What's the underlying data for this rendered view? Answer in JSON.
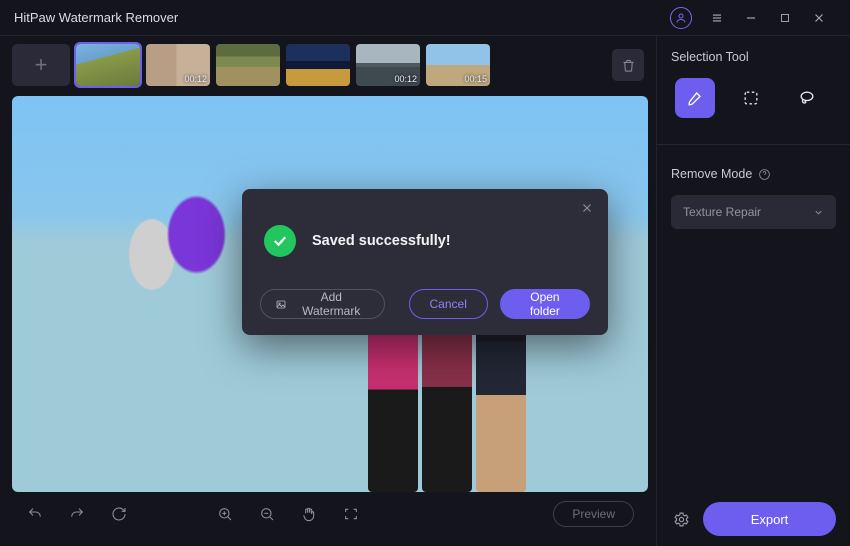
{
  "titlebar": {
    "title": "HitPaw Watermark Remover"
  },
  "thumbnails": {
    "items": [
      {
        "duration": ""
      },
      {
        "duration": "00:12"
      },
      {
        "duration": ""
      },
      {
        "duration": ""
      },
      {
        "duration": "00:12"
      },
      {
        "duration": "00:15"
      }
    ]
  },
  "modal": {
    "message": "Saved successfully!",
    "add_watermark": "Add Watermark",
    "cancel": "Cancel",
    "open_folder": "Open folder"
  },
  "bottombar": {
    "preview": "Preview"
  },
  "right_panel": {
    "selection_title": "Selection Tool",
    "remove_mode_title": "Remove Mode",
    "remove_mode_value": "Texture Repair",
    "export": "Export"
  }
}
